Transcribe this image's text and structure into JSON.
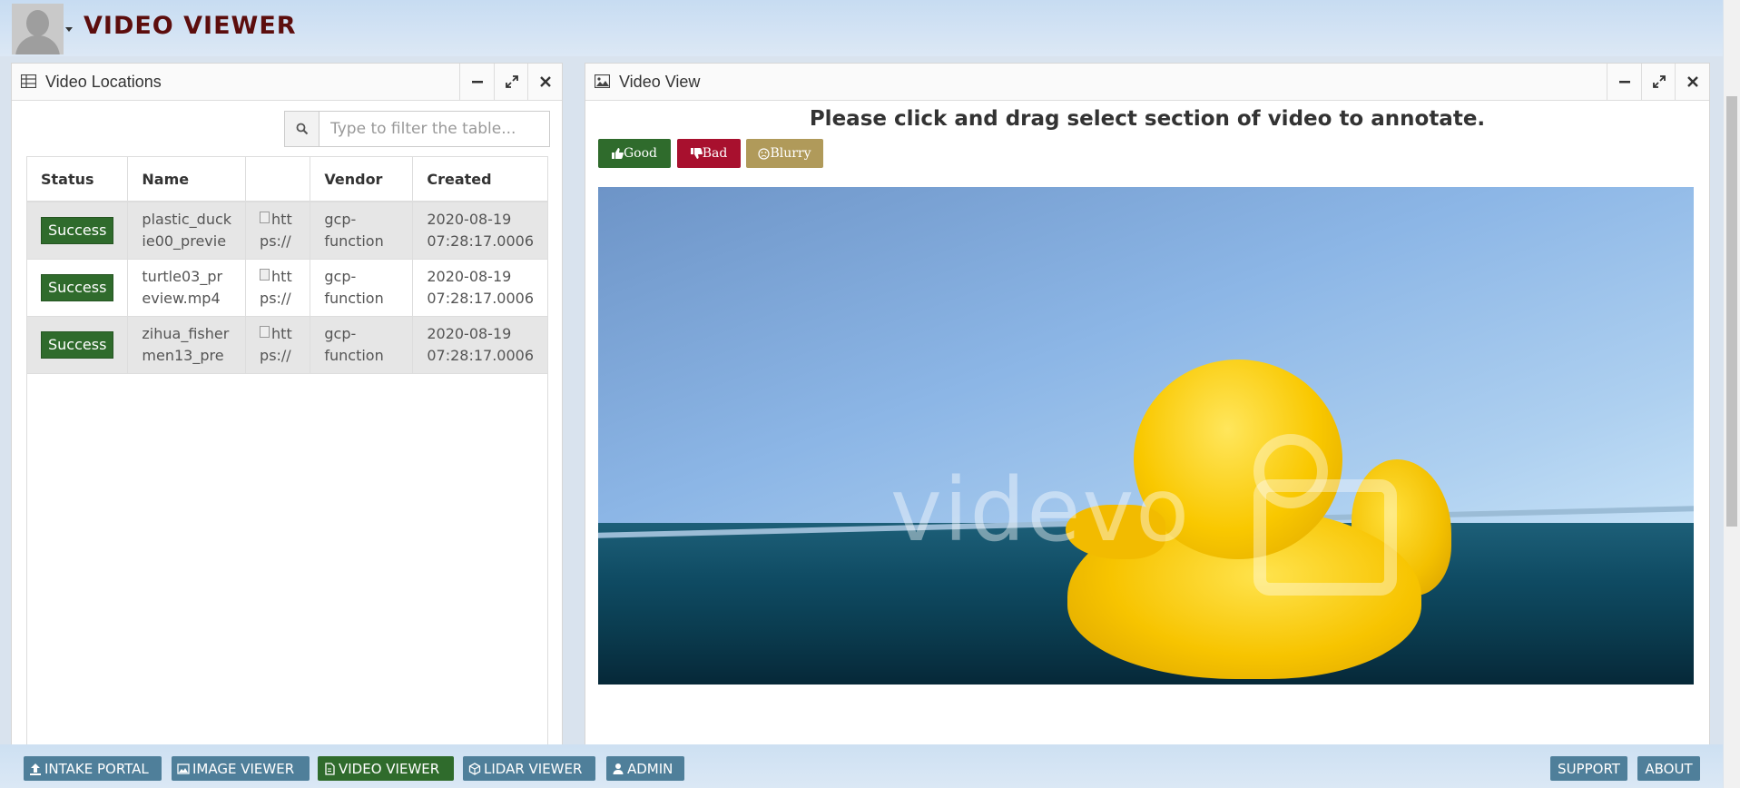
{
  "app": {
    "title": "VIDEO VIEWER"
  },
  "left_panel": {
    "title": "Video Locations",
    "filter_placeholder": "Type to filter the table...",
    "columns": [
      "Status",
      "Name",
      "",
      "Vendor",
      "Created"
    ],
    "rows": [
      {
        "status": "Success",
        "name_l1": "plastic_duck",
        "name_l2": "ie00_previe",
        "img_l1": "htt",
        "img_l2": "ps://",
        "vendor_l1": "gcp-",
        "vendor_l2": "function",
        "created_l1": "2020-08-19",
        "created_l2": "07:28:17.0006"
      },
      {
        "status": "Success",
        "name_l1": "turtle03_pr",
        "name_l2": "eview.mp4",
        "img_l1": "htt",
        "img_l2": "ps://",
        "vendor_l1": "gcp-",
        "vendor_l2": "function",
        "created_l1": "2020-08-19",
        "created_l2": "07:28:17.0006"
      },
      {
        "status": "Success",
        "name_l1": "zihua_fisher",
        "name_l2": "men13_pre",
        "img_l1": "htt",
        "img_l2": "ps://",
        "vendor_l1": "gcp-",
        "vendor_l2": "function",
        "created_l1": "2020-08-19",
        "created_l2": "07:28:17.0006"
      }
    ]
  },
  "right_panel": {
    "title": "Video View",
    "instruction": "Please click and drag select section of video to annotate.",
    "buttons": {
      "good": "Good",
      "bad": "Bad",
      "blurry": "Blurry"
    },
    "watermark": "videvo"
  },
  "footer": {
    "intake": "INTAKE PORTAL",
    "image_viewer": "IMAGE VIEWER",
    "video_viewer": "VIDEO VIEWER",
    "lidar_viewer": "LIDAR VIEWER",
    "admin": "ADMIN",
    "support": "SUPPORT",
    "about": "ABOUT"
  },
  "colors": {
    "title": "#5c0d0d",
    "success": "#2f6b2c",
    "good": "#2f6b2c",
    "bad": "#a8102e",
    "blurry": "#b09a5a",
    "footer_button": "#4f7f9a"
  },
  "icons": [
    "user-avatar-icon",
    "caret-down-icon",
    "table-icon",
    "image-icon",
    "minimize-icon",
    "expand-icon",
    "close-icon",
    "search-icon",
    "thumbs-up-icon",
    "thumbs-down-icon",
    "frown-icon",
    "upload-icon",
    "file-icon",
    "cube-icon",
    "user-icon"
  ]
}
